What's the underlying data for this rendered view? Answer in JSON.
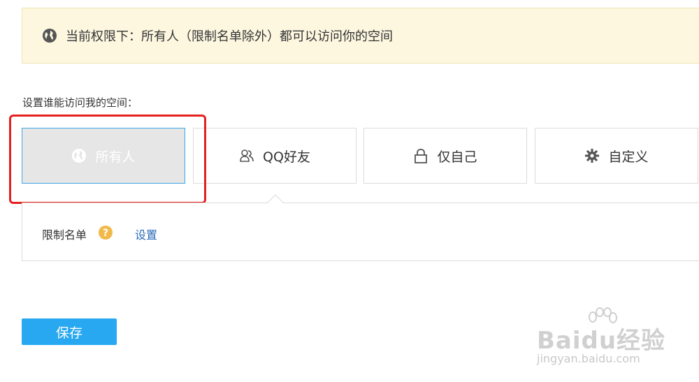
{
  "notice": {
    "text": "当前权限下：所有人（限制名单除外）都可以访问你的空间",
    "icon": "globe-icon",
    "background": "#fdf7e0"
  },
  "access": {
    "label": "设置谁能访问我的空间：",
    "options": [
      {
        "label": "所有人",
        "icon": "globe-icon",
        "selected": true
      },
      {
        "label": "QQ好友",
        "icon": "friends-icon",
        "selected": false
      },
      {
        "label": "仅自己",
        "icon": "lock-icon",
        "selected": false
      },
      {
        "label": "自定义",
        "icon": "gear-icon",
        "selected": false
      }
    ],
    "selected_border": "#3fa7e6"
  },
  "restrict": {
    "label": "限制名单",
    "help_icon": "question-icon",
    "link": "设置"
  },
  "save": {
    "label": "保存",
    "color": "#27a8f0"
  },
  "watermark": {
    "main": "Baidu经验",
    "sub": "jingyan.baidu.com"
  },
  "annotation_color": "#e62020"
}
